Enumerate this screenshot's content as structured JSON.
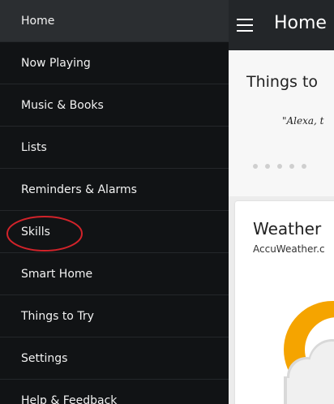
{
  "sidebar": {
    "items": [
      {
        "label": "Home"
      },
      {
        "label": "Now Playing"
      },
      {
        "label": "Music & Books"
      },
      {
        "label": "Lists"
      },
      {
        "label": "Reminders & Alarms"
      },
      {
        "label": "Skills"
      },
      {
        "label": "Smart Home"
      },
      {
        "label": "Things to Try"
      },
      {
        "label": "Settings"
      },
      {
        "label": "Help & Feedback"
      }
    ],
    "highlight_color": "#d2232a"
  },
  "header": {
    "title": "Home",
    "menu_icon": "hamburger-menu-icon"
  },
  "things_to_try": {
    "title": "Things to",
    "quote": "\"Alexa, t",
    "dots_count": 5
  },
  "weather_card": {
    "title": "Weather",
    "source": "AccuWeather.c",
    "icon": "sun-behind-cloud-icon"
  },
  "colors": {
    "sidebar_bg": "#111315",
    "topbar_bg": "#232629",
    "sun": "#f5a400",
    "cloud": "#f0f0f0"
  }
}
